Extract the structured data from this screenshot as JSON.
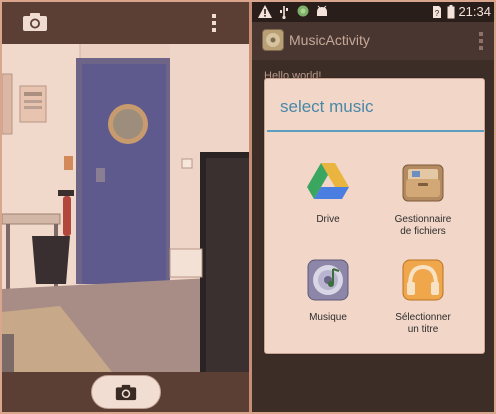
{
  "camera": {
    "top_icon": "camera-icon",
    "menu_icon": "overflow-menu-icon",
    "shutter_icon": "camera-icon"
  },
  "statusbar": {
    "icons": [
      "warning-icon",
      "usb-icon",
      "sync-icon",
      "android-icon",
      "sim-icon",
      "signal-icon",
      "battery-icon"
    ],
    "time": "21:34"
  },
  "app": {
    "title": "MusicActivity",
    "body_text": "Hello world!"
  },
  "dialog": {
    "title": "select music",
    "options": [
      {
        "label": "Drive",
        "icon": "google-drive-icon"
      },
      {
        "label_line1": "Gestionnaire",
        "label_line2": "de fichiers",
        "icon": "file-manager-icon"
      },
      {
        "label": "Musique",
        "icon": "music-disc-icon"
      },
      {
        "label_line1": "Sélectionner",
        "label_line2": "un titre",
        "icon": "headphones-icon"
      }
    ]
  },
  "colors": {
    "accent": "#4a88a8",
    "divider": "#5d9dc0",
    "dialog_bg": "#f2d6c8"
  }
}
